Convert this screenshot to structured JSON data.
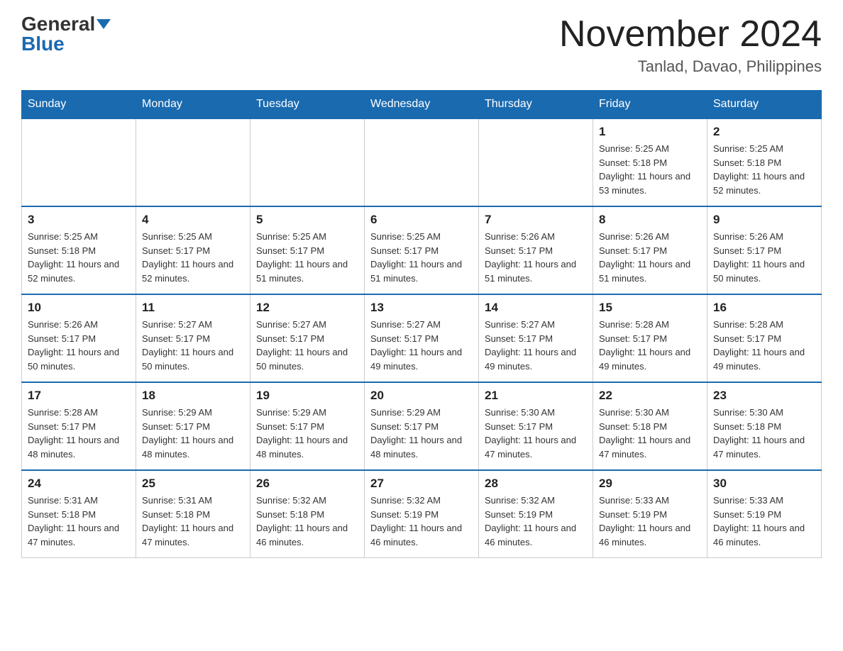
{
  "header": {
    "logo_general": "General",
    "logo_blue": "Blue",
    "month_title": "November 2024",
    "location": "Tanlad, Davao, Philippines"
  },
  "days_of_week": [
    "Sunday",
    "Monday",
    "Tuesday",
    "Wednesday",
    "Thursday",
    "Friday",
    "Saturday"
  ],
  "weeks": [
    [
      {
        "day": "",
        "info": ""
      },
      {
        "day": "",
        "info": ""
      },
      {
        "day": "",
        "info": ""
      },
      {
        "day": "",
        "info": ""
      },
      {
        "day": "",
        "info": ""
      },
      {
        "day": "1",
        "info": "Sunrise: 5:25 AM\nSunset: 5:18 PM\nDaylight: 11 hours and 53 minutes."
      },
      {
        "day": "2",
        "info": "Sunrise: 5:25 AM\nSunset: 5:18 PM\nDaylight: 11 hours and 52 minutes."
      }
    ],
    [
      {
        "day": "3",
        "info": "Sunrise: 5:25 AM\nSunset: 5:18 PM\nDaylight: 11 hours and 52 minutes."
      },
      {
        "day": "4",
        "info": "Sunrise: 5:25 AM\nSunset: 5:17 PM\nDaylight: 11 hours and 52 minutes."
      },
      {
        "day": "5",
        "info": "Sunrise: 5:25 AM\nSunset: 5:17 PM\nDaylight: 11 hours and 51 minutes."
      },
      {
        "day": "6",
        "info": "Sunrise: 5:25 AM\nSunset: 5:17 PM\nDaylight: 11 hours and 51 minutes."
      },
      {
        "day": "7",
        "info": "Sunrise: 5:26 AM\nSunset: 5:17 PM\nDaylight: 11 hours and 51 minutes."
      },
      {
        "day": "8",
        "info": "Sunrise: 5:26 AM\nSunset: 5:17 PM\nDaylight: 11 hours and 51 minutes."
      },
      {
        "day": "9",
        "info": "Sunrise: 5:26 AM\nSunset: 5:17 PM\nDaylight: 11 hours and 50 minutes."
      }
    ],
    [
      {
        "day": "10",
        "info": "Sunrise: 5:26 AM\nSunset: 5:17 PM\nDaylight: 11 hours and 50 minutes."
      },
      {
        "day": "11",
        "info": "Sunrise: 5:27 AM\nSunset: 5:17 PM\nDaylight: 11 hours and 50 minutes."
      },
      {
        "day": "12",
        "info": "Sunrise: 5:27 AM\nSunset: 5:17 PM\nDaylight: 11 hours and 50 minutes."
      },
      {
        "day": "13",
        "info": "Sunrise: 5:27 AM\nSunset: 5:17 PM\nDaylight: 11 hours and 49 minutes."
      },
      {
        "day": "14",
        "info": "Sunrise: 5:27 AM\nSunset: 5:17 PM\nDaylight: 11 hours and 49 minutes."
      },
      {
        "day": "15",
        "info": "Sunrise: 5:28 AM\nSunset: 5:17 PM\nDaylight: 11 hours and 49 minutes."
      },
      {
        "day": "16",
        "info": "Sunrise: 5:28 AM\nSunset: 5:17 PM\nDaylight: 11 hours and 49 minutes."
      }
    ],
    [
      {
        "day": "17",
        "info": "Sunrise: 5:28 AM\nSunset: 5:17 PM\nDaylight: 11 hours and 48 minutes."
      },
      {
        "day": "18",
        "info": "Sunrise: 5:29 AM\nSunset: 5:17 PM\nDaylight: 11 hours and 48 minutes."
      },
      {
        "day": "19",
        "info": "Sunrise: 5:29 AM\nSunset: 5:17 PM\nDaylight: 11 hours and 48 minutes."
      },
      {
        "day": "20",
        "info": "Sunrise: 5:29 AM\nSunset: 5:17 PM\nDaylight: 11 hours and 48 minutes."
      },
      {
        "day": "21",
        "info": "Sunrise: 5:30 AM\nSunset: 5:17 PM\nDaylight: 11 hours and 47 minutes."
      },
      {
        "day": "22",
        "info": "Sunrise: 5:30 AM\nSunset: 5:18 PM\nDaylight: 11 hours and 47 minutes."
      },
      {
        "day": "23",
        "info": "Sunrise: 5:30 AM\nSunset: 5:18 PM\nDaylight: 11 hours and 47 minutes."
      }
    ],
    [
      {
        "day": "24",
        "info": "Sunrise: 5:31 AM\nSunset: 5:18 PM\nDaylight: 11 hours and 47 minutes."
      },
      {
        "day": "25",
        "info": "Sunrise: 5:31 AM\nSunset: 5:18 PM\nDaylight: 11 hours and 47 minutes."
      },
      {
        "day": "26",
        "info": "Sunrise: 5:32 AM\nSunset: 5:18 PM\nDaylight: 11 hours and 46 minutes."
      },
      {
        "day": "27",
        "info": "Sunrise: 5:32 AM\nSunset: 5:19 PM\nDaylight: 11 hours and 46 minutes."
      },
      {
        "day": "28",
        "info": "Sunrise: 5:32 AM\nSunset: 5:19 PM\nDaylight: 11 hours and 46 minutes."
      },
      {
        "day": "29",
        "info": "Sunrise: 5:33 AM\nSunset: 5:19 PM\nDaylight: 11 hours and 46 minutes."
      },
      {
        "day": "30",
        "info": "Sunrise: 5:33 AM\nSunset: 5:19 PM\nDaylight: 11 hours and 46 minutes."
      }
    ]
  ]
}
